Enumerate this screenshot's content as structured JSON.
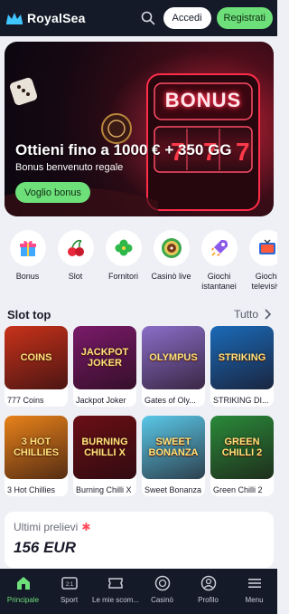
{
  "header": {
    "brand": "RoyalSea",
    "login_label": "Accedi",
    "register_label": "Registrati",
    "search_icon": "search-icon"
  },
  "hero": {
    "sign_text": "BONUS",
    "title": "Ottieni fino a 1000 € + 350 GG",
    "subtitle": "Bonus benvenuto regale",
    "cta_label": "Voglio bonus"
  },
  "categories": [
    {
      "label": "Bonus",
      "icon": "gift-icon"
    },
    {
      "label": "Slot",
      "icon": "cherry-icon"
    },
    {
      "label": "Fornitori",
      "icon": "clover-icon"
    },
    {
      "label": "Casinò live",
      "icon": "roulette-icon"
    },
    {
      "label": "Giochi istantanei",
      "icon": "rocket-icon"
    },
    {
      "label": "Giochi televisivi",
      "icon": "tv-icon"
    }
  ],
  "top_slots": {
    "title": "Slot top",
    "view_all_label": "Tutto",
    "games": [
      {
        "name": "777 Coins",
        "art_text": "COINS",
        "bg": "#c8321a"
      },
      {
        "name": "Jackpot Joker",
        "art_text": "JACKPOT JOKER",
        "bg": "#7a1a6a"
      },
      {
        "name": "Gates of Oly...",
        "art_text": "OLYMPUS",
        "bg": "#8a6ec8"
      },
      {
        "name": "STRIKING DI...",
        "art_text": "STRIKING",
        "bg": "#1a6ab8"
      },
      {
        "name": "3 Hot Chillies",
        "art_text": "3 HOT CHILLIES",
        "bg": "#e8821a"
      },
      {
        "name": "Burning Chilli X",
        "art_text": "BURNING CHILLI X",
        "bg": "#6a0f14"
      },
      {
        "name": "Sweet Bonanza",
        "art_text": "SWEET BONANZA",
        "bg": "#5ac8e8"
      },
      {
        "name": "Green Chilli 2",
        "art_text": "GREEN CHILLI 2",
        "bg": "#2a8a3a"
      }
    ]
  },
  "withdrawals": {
    "label": "Ultimi prelievi",
    "amount": "156 EUR"
  },
  "bottom_nav": [
    {
      "label": "Principale",
      "icon": "home-icon",
      "active": true
    },
    {
      "label": "Sport",
      "icon": "scoreboard-icon",
      "active": false
    },
    {
      "label": "Le mie scom...",
      "icon": "ticket-icon",
      "active": false
    },
    {
      "label": "Casinò",
      "icon": "chip-icon",
      "active": false
    },
    {
      "label": "Profilo",
      "icon": "user-icon",
      "active": false
    },
    {
      "label": "Menu",
      "icon": "menu-icon",
      "active": false
    }
  ],
  "colors": {
    "accent": "#6ee07a",
    "header_bg": "#141a28",
    "page_bg": "#eef0f5"
  }
}
